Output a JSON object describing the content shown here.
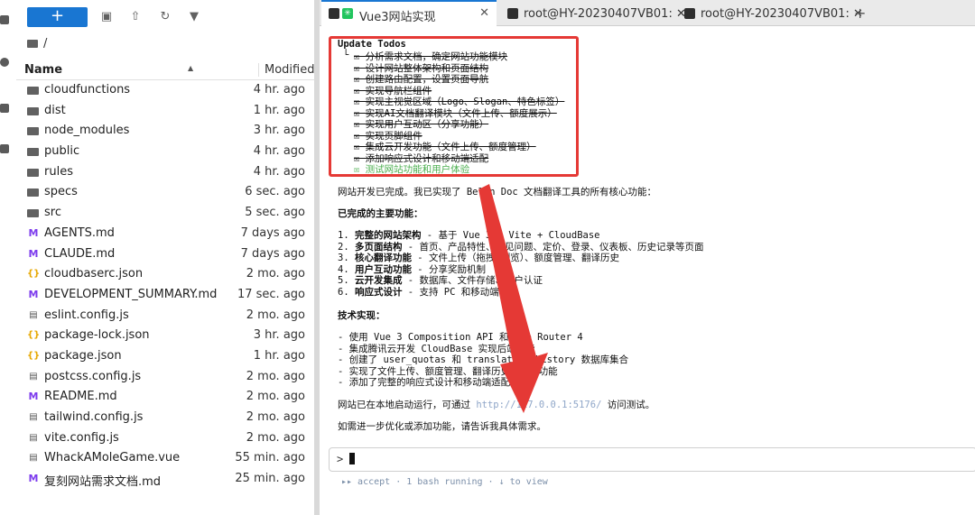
{
  "toolbar": {
    "new_label": "+"
  },
  "breadcrumb": "/",
  "list_header": {
    "name": "Name",
    "modified": "Modified"
  },
  "files": [
    {
      "name": "cloudfunctions",
      "time": "4 hr. ago",
      "type": "folder"
    },
    {
      "name": "dist",
      "time": "1 hr. ago",
      "type": "folder"
    },
    {
      "name": "node_modules",
      "time": "3 hr. ago",
      "type": "folder"
    },
    {
      "name": "public",
      "time": "4 hr. ago",
      "type": "folder"
    },
    {
      "name": "rules",
      "time": "4 hr. ago",
      "type": "folder"
    },
    {
      "name": "specs",
      "time": "6 sec. ago",
      "type": "folder"
    },
    {
      "name": "src",
      "time": "5 sec. ago",
      "type": "folder"
    },
    {
      "name": "AGENTS.md",
      "time": "7 days ago",
      "type": "md"
    },
    {
      "name": "CLAUDE.md",
      "time": "7 days ago",
      "type": "md"
    },
    {
      "name": "cloudbaserc.json",
      "time": "2 mo. ago",
      "type": "json"
    },
    {
      "name": "DEVELOPMENT_SUMMARY.md",
      "time": "17 sec. ago",
      "type": "md"
    },
    {
      "name": "eslint.config.js",
      "time": "2 mo. ago",
      "type": "js"
    },
    {
      "name": "package-lock.json",
      "time": "3 hr. ago",
      "type": "json"
    },
    {
      "name": "package.json",
      "time": "1 hr. ago",
      "type": "json"
    },
    {
      "name": "postcss.config.js",
      "time": "2 mo. ago",
      "type": "js"
    },
    {
      "name": "README.md",
      "time": "2 mo. ago",
      "type": "md"
    },
    {
      "name": "tailwind.config.js",
      "time": "2 mo. ago",
      "type": "js"
    },
    {
      "name": "vite.config.js",
      "time": "2 mo. ago",
      "type": "js"
    },
    {
      "name": "WhackAMoleGame.vue",
      "time": "55 min. ago",
      "type": "vue"
    },
    {
      "name": "复刻网站需求文档.md",
      "time": "25 min. ago",
      "type": "md"
    }
  ],
  "tabs": [
    {
      "title": "Vue3网站实现",
      "close": "✕"
    },
    {
      "title": "root@HY-20230407VB01: ✕",
      "close": "✕"
    },
    {
      "title": "root@HY-20230407VB01: ✕",
      "close": "✕"
    }
  ],
  "tab_add": "+",
  "terminal": {
    "todos_title": "Update Todos",
    "todo_prefix": "└",
    "todos": [
      "☒ 分析需求文档，确定网站功能模块",
      "☒ 设计网站整体架构和页面结构",
      "☒ 创建路由配置，设置页面导航",
      "☒ 实现导航栏组件",
      "☒ 实现主视觉区域（Logo、Slogan、特色标签）",
      "☒ 实现AI文档翻译模块（文件上传、额度展示）",
      "☒ 实现用户互动区（分享功能）",
      "☒ 实现页脚组件",
      "☒ 集成云开发功能（文件上传、额度管理）",
      "☒ 添加响应式设计和移动端适配",
      "☒ 测试网站功能和用户体验"
    ],
    "summary": "网站开发已完成。我已实现了 Belin Doc 文档翻译工具的所有核心功能：",
    "features_title": "已完成的主要功能：",
    "features": [
      {
        "num": "1.",
        "bold": "完整的网站架构",
        "text": " - 基于 Vue 3 + Vite + CloudBase"
      },
      {
        "num": "2.",
        "bold": "多页面结构",
        "text": " - 首页、产品特性、常见问题、定价、登录、仪表板、历史记录等页面"
      },
      {
        "num": "3.",
        "bold": "核心翻译功能",
        "text": " - 文件上传（拖拽/浏览）、额度管理、翻译历史"
      },
      {
        "num": "4.",
        "bold": "用户互动功能",
        "text": " - 分享奖励机制"
      },
      {
        "num": "5.",
        "bold": "云开发集成",
        "text": " - 数据库、文件存储、用户认证"
      },
      {
        "num": "6.",
        "bold": "响应式设计",
        "text": " - 支持 PC 和移动端访问"
      }
    ],
    "tech_title": "技术实现：",
    "tech": [
      "- 使用 Vue 3 Composition API 和 Vue Router 4",
      "- 集成腾讯云开发 CloudBase 实现后端功能",
      "- 创建了 user_quotas 和 translation_history 数据库集合",
      "- 实现了文件上传、额度管理、翻译历史等核心功能",
      "- 添加了完整的响应式设计和移动端适配"
    ],
    "run_prefix": "网站已在本地启动运行，可通过 ",
    "run_link": "http://127.0.0.1:5176/",
    "run_suffix": " 访问测试。",
    "closing": "如需进一步优化或添加功能，请告诉我具体需求。",
    "prompt": ">",
    "status": "▸▸ accept  ·  1 bash running  ·  ↓ to view"
  }
}
